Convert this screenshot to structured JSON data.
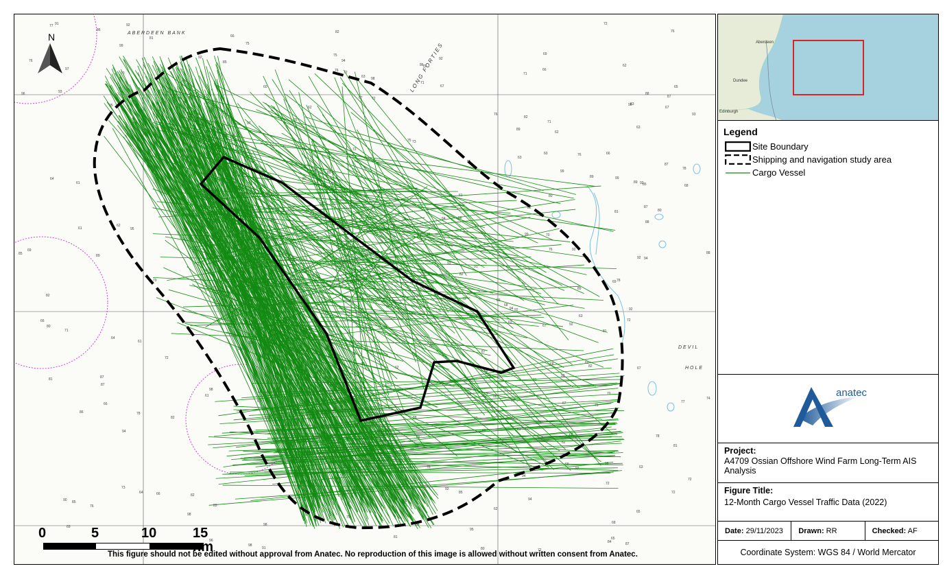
{
  "map": {
    "place_labels": {
      "aberdeen_bank": "ABERDEEN BANK",
      "long_forties": "LONG FORTIES",
      "devils": "DEVIL",
      "hole": "HOLE"
    },
    "north_label": "N",
    "scale_bar": {
      "ticks": [
        "0",
        "5",
        "10",
        "15 nm"
      ]
    },
    "disclaimer": "This figure should not be edited without approval from Anatec. No reproduction of this image is allowed without written consent from Anatec."
  },
  "inset": {
    "labels": [
      "Aberdeen",
      "Dundee",
      "Edinburgh"
    ]
  },
  "legend": {
    "title": "Legend",
    "items": [
      {
        "label": "Site Boundary",
        "symbol": "solid-black-outline"
      },
      {
        "label": "Shipping and navigation study area",
        "symbol": "dashed-black-outline"
      },
      {
        "label": "Cargo Vessel",
        "symbol": "green-line",
        "color": "#1b8a1b"
      }
    ]
  },
  "logo": {
    "word": "anatec",
    "color": "#1f5a9a"
  },
  "project": {
    "title": "Project:",
    "text": "A4709 Ossian Offshore Wind Farm Long-Term AIS Analysis"
  },
  "figure": {
    "title": "Figure Title:",
    "text": "12-Month Cargo Vessel Traffic Data (2022)"
  },
  "meta": {
    "date_label": "Date:",
    "date_value": "29/11/2023",
    "drawn_label": "Drawn:",
    "drawn_value": "RR",
    "checked_label": "Checked:",
    "checked_value": "AF"
  },
  "coordinate_system": "Coordinate System: WGS 84 / World Mercator",
  "colors": {
    "traffic": "#138a13",
    "boundary": "#000000",
    "inset_sea": "#a6d2e0",
    "inset_land": "#e6ecd8",
    "inset_frame": "#e01010",
    "magenta": "#d040d0"
  }
}
